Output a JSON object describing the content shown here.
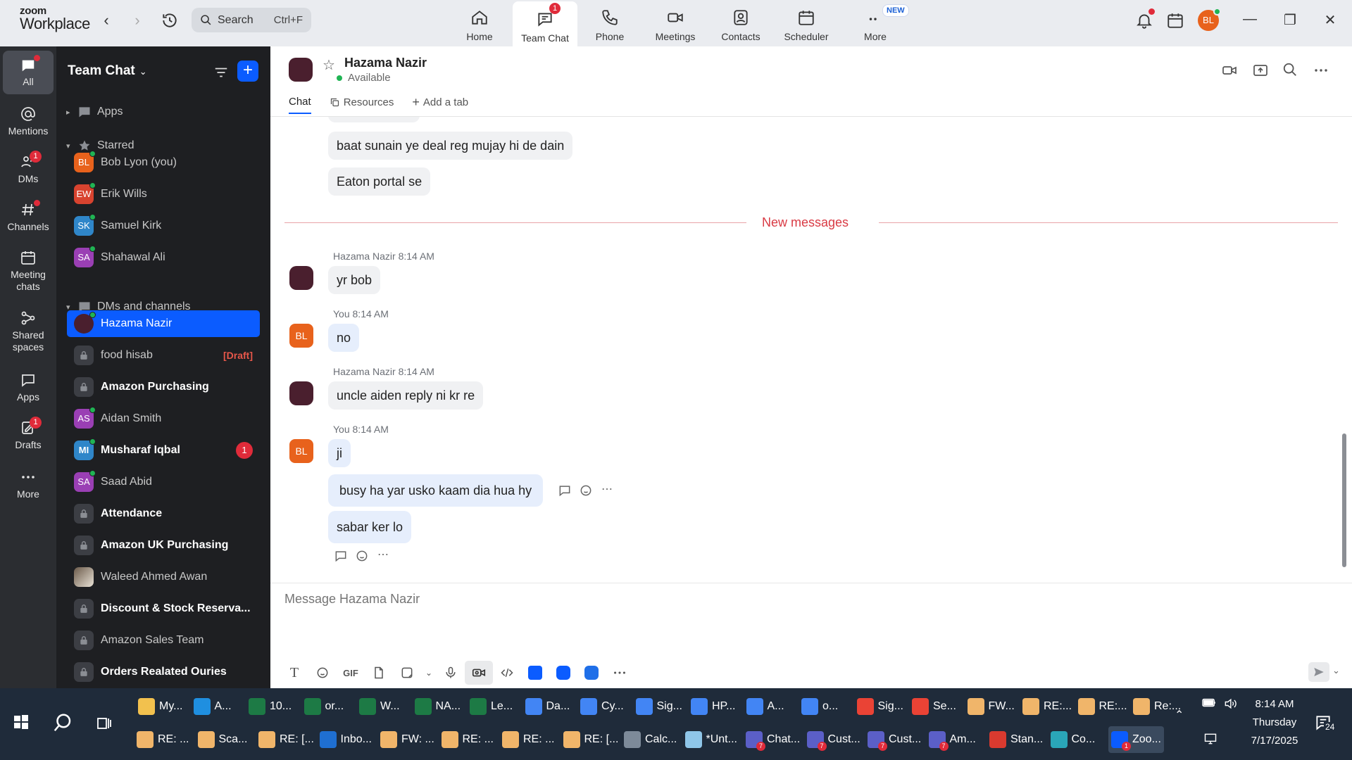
{
  "app": {
    "logo_line1": "zoom",
    "logo_line2": "Workplace",
    "search_label": "Search",
    "search_shortcut": "Ctrl+F"
  },
  "nav_tabs": [
    {
      "label": "Home",
      "icon": "home-icon"
    },
    {
      "label": "Team Chat",
      "icon": "chat-icon",
      "badge": "1",
      "active": true
    },
    {
      "label": "Phone",
      "icon": "phone-icon"
    },
    {
      "label": "Meetings",
      "icon": "video-icon"
    },
    {
      "label": "Contacts",
      "icon": "contacts-icon"
    },
    {
      "label": "Scheduler",
      "icon": "calendar-icon"
    },
    {
      "label": "More",
      "icon": "more-icon",
      "tag": "NEW"
    }
  ],
  "user_avatar": "BL",
  "rail": [
    {
      "label": "All",
      "icon": "chat-bubble-icon",
      "active": true
    },
    {
      "label": "Mentions",
      "icon": "at-icon"
    },
    {
      "label": "DMs",
      "icon": "people-icon",
      "badge": "1"
    },
    {
      "label": "Channels",
      "icon": "hash-icon"
    },
    {
      "label": "Meeting chats",
      "icon": "calendar-icon"
    },
    {
      "label": "Shared spaces",
      "icon": "share-icon"
    },
    {
      "label": "Apps",
      "icon": "apps-icon"
    },
    {
      "label": "Drafts",
      "icon": "draft-icon",
      "badge": "1"
    },
    {
      "label": "More",
      "icon": "ellipsis-icon"
    }
  ],
  "sidebar": {
    "title": "Team Chat",
    "sections": {
      "apps": "Apps",
      "starred": "Starred",
      "dms": "DMs and channels"
    },
    "starred": [
      {
        "initials": "BL",
        "name": "Bob Lyon (you)",
        "color": "#e8621c"
      },
      {
        "initials": "EW",
        "name": "Erik Wills",
        "color": "#d8432f"
      },
      {
        "initials": "SK",
        "name": "Samuel Kirk",
        "color": "#2f86c9"
      },
      {
        "initials": "SA",
        "name": "Shahawal Ali",
        "color": "#9a3fb4"
      }
    ],
    "chats": [
      {
        "initials": "",
        "name": "Hazama Nazir",
        "type": "dm-photo",
        "selected": true
      },
      {
        "initials": "",
        "name": "food hisab",
        "type": "lock",
        "draft": "[Draft]"
      },
      {
        "initials": "",
        "name": "Amazon Purchasing",
        "type": "lock",
        "bold": true
      },
      {
        "initials": "AS",
        "name": "Aidan Smith",
        "type": "dm",
        "color": "#9a3fb4"
      },
      {
        "initials": "MI",
        "name": "Musharaf Iqbal",
        "type": "dm",
        "color": "#2f86c9",
        "bold": true,
        "unread": "1"
      },
      {
        "initials": "SA",
        "name": "Saad Abid",
        "type": "dm",
        "color": "#9a3fb4"
      },
      {
        "initials": "",
        "name": "Attendance",
        "type": "lock",
        "bold": true
      },
      {
        "initials": "",
        "name": "Amazon UK Purchasing",
        "type": "lock",
        "bold": true
      },
      {
        "initials": "",
        "name": "Waleed Ahmed Awan",
        "type": "dm-photo2"
      },
      {
        "initials": "",
        "name": "Discount & Stock Reserva...",
        "type": "lock",
        "bold": true
      },
      {
        "initials": "",
        "name": "Amazon Sales Team",
        "type": "lock"
      },
      {
        "initials": "",
        "name": "Orders Realated Ouries",
        "type": "lock",
        "bold": true
      }
    ]
  },
  "chat": {
    "contact_name": "Hazama Nazir",
    "status": "Available",
    "tabs": [
      "Chat",
      "Resources",
      "Add a tab"
    ],
    "new_messages_label": "New messages",
    "messages": {
      "m1": "baat sunain ye deal reg mujay hi de dain",
      "m2": "Eaton portal se",
      "g1_meta": "Hazama Nazir 8:14 AM",
      "m3": "yr bob",
      "g2_meta": "You 8:14 AM",
      "m4": "no",
      "g3_meta": "Hazama Nazir 8:14 AM",
      "m5": "uncle aiden  reply ni kr re",
      "g4_meta": "You 8:14 AM",
      "m6": "ji",
      "m7": "busy ha yar usko kaam dia hua hy",
      "m8": "sabar ker lo"
    },
    "composer_placeholder": "Message Hazama Nazir",
    "toolbar_gif": "GIF"
  },
  "taskbar": {
    "row1": [
      {
        "label": "My...",
        "color": "#f2c14e"
      },
      {
        "label": "A...",
        "color": "#1f8fe0"
      },
      {
        "label": "10...",
        "color": "#1d7a45"
      },
      {
        "label": "or...",
        "color": "#1d7a45"
      },
      {
        "label": "W...",
        "color": "#1d7a45"
      },
      {
        "label": "NA...",
        "color": "#1d7a45"
      },
      {
        "label": "Le...",
        "color": "#1d7a45"
      },
      {
        "label": "Da...",
        "color": "#4285f4"
      },
      {
        "label": "Cy...",
        "color": "#4285f4"
      },
      {
        "label": "Sig...",
        "color": "#4285f4"
      },
      {
        "label": "HP...",
        "color": "#4285f4"
      },
      {
        "label": "A...",
        "color": "#4285f4"
      },
      {
        "label": "o...",
        "color": "#4285f4"
      },
      {
        "label": "Sig...",
        "color": "#ea4335"
      },
      {
        "label": "Se...",
        "color": "#ea4335"
      },
      {
        "label": "FW...",
        "color": "#f0b56a"
      },
      {
        "label": "RE:...",
        "color": "#f0b56a"
      },
      {
        "label": "RE:...",
        "color": "#f0b56a"
      },
      {
        "label": "Re:...",
        "color": "#f0b56a"
      }
    ],
    "row2": [
      {
        "label": "RE: ...",
        "color": "#f0b56a"
      },
      {
        "label": "Sca...",
        "color": "#f0b56a"
      },
      {
        "label": "RE: [...",
        "color": "#f0b56a"
      },
      {
        "label": "Inbo...",
        "color": "#1f6fd1"
      },
      {
        "label": "FW: ...",
        "color": "#f0b56a"
      },
      {
        "label": "RE: ...",
        "color": "#f0b56a"
      },
      {
        "label": "RE: ...",
        "color": "#f0b56a"
      },
      {
        "label": "RE: [...",
        "color": "#f0b56a"
      },
      {
        "label": "Calc...",
        "color": "#7d8a99"
      },
      {
        "label": "*Unt...",
        "color": "#8fc6e8"
      },
      {
        "label": "Chat...",
        "color": "#5b5fc7",
        "badge": "7"
      },
      {
        "label": "Cust...",
        "color": "#5b5fc7",
        "badge": "7"
      },
      {
        "label": "Cust...",
        "color": "#5b5fc7",
        "badge": "7"
      },
      {
        "label": "Am...",
        "color": "#5b5fc7",
        "badge": "7"
      },
      {
        "label": "Stan...",
        "color": "#d93a2f"
      },
      {
        "label": "Co...",
        "color": "#2aa6b8"
      },
      {
        "label": "Zoo...",
        "color": "#0b5cff",
        "badge": "1",
        "active": true
      }
    ],
    "time": "8:14 AM",
    "day": "Thursday",
    "date": "7/17/2025",
    "notif_count": "24"
  }
}
